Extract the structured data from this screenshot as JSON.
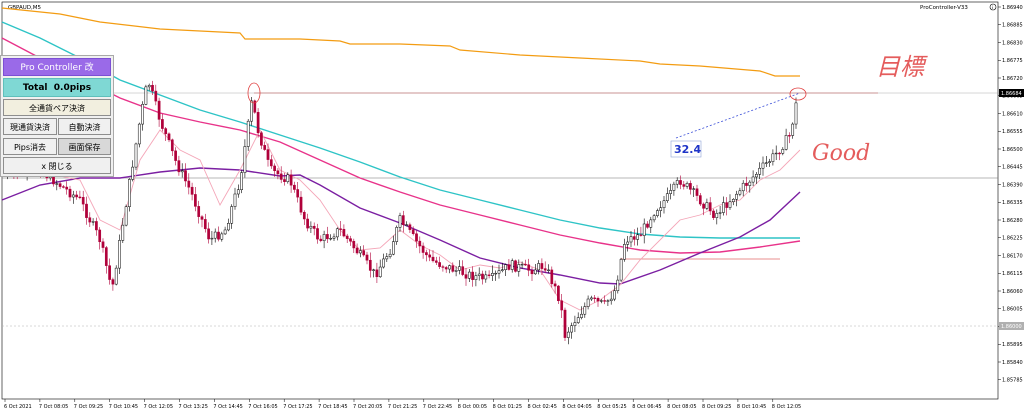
{
  "header": {
    "symbol_label": "GBPAUD,M5",
    "indicator_label": "ProController-V33",
    "indicator_icon": "circle-info-icon"
  },
  "price_axis": {
    "ticks": [
      "1.86940",
      "1.86885",
      "1.86830",
      "1.86775",
      "1.86720",
      "1.86665",
      "1.86610",
      "1.86555",
      "1.86500",
      "1.86445",
      "1.86390",
      "1.86335",
      "1.86280",
      "1.86225",
      "1.86170",
      "1.86115",
      "1.86060",
      "1.86005",
      "1.85950",
      "1.85895",
      "1.85840",
      "1.85785"
    ],
    "current_price": "1.86684",
    "lower_price": "1.86000",
    "current_price_color": "#000000",
    "lower_price_color": "#b0b0b0"
  },
  "time_axis": {
    "labels": [
      "6 Oct 2021",
      "7 Oct 08:05",
      "7 Oct 09:25",
      "7 Oct 10:45",
      "7 Oct 12:05",
      "7 Oct 13:25",
      "7 Oct 14:45",
      "7 Oct 16:05",
      "7 Oct 17:25",
      "7 Oct 18:45",
      "7 Oct 20:05",
      "7 Oct 21:25",
      "7 Oct 22:45",
      "8 Oct 00:05",
      "8 Oct 01:25",
      "8 Oct 02:45",
      "8 Oct 04:05",
      "8 Oct 05:25",
      "8 Oct 06:45",
      "8 Oct 08:05",
      "8 Oct 09:25",
      "8 Oct 10:45",
      "8 Oct 12:05"
    ]
  },
  "panel": {
    "title": "Pro Controller 改",
    "total_label": "Total",
    "total_value": "0.0pips",
    "all_close": "全通貨ペア決済",
    "current_close": "現通貨決済",
    "auto_close": "自動決済",
    "pips_clear": "Pips消去",
    "screen_save": "画面保存",
    "close": "x 閉じる"
  },
  "annotations": {
    "pips_box": "32.4",
    "handwritten_target": "目標",
    "handwritten_good": "Good"
  },
  "colors": {
    "bull_candle": "#000000",
    "bear_candle": "#b0003a",
    "ma_orange": "#f39c12",
    "ma_cyan": "#2ec4c6",
    "ma_magenta": "#e8338a",
    "ma_purple": "#7b1fa2",
    "ma_pink": "#f4a6b8",
    "annotation_red": "#e04040",
    "trendline_blue": "#3b4fd8"
  }
}
